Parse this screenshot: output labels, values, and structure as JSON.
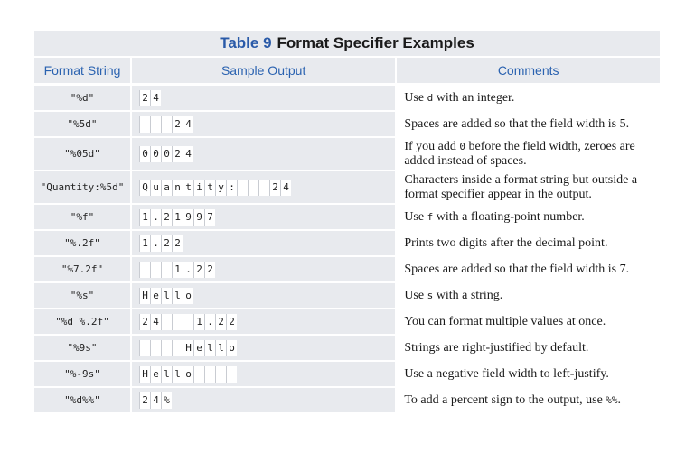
{
  "table": {
    "title_number": "Table 9",
    "title_text": "Format Specifier Examples",
    "headers": [
      "Format String",
      "Sample Output",
      "Comments"
    ],
    "rows": [
      {
        "format": "\"%d\"",
        "output": "24",
        "pad": 0,
        "comment": [
          [
            "t",
            "Use "
          ],
          [
            "c",
            "d"
          ],
          [
            "t",
            " with an integer."
          ]
        ]
      },
      {
        "format": "\"%5d\"",
        "output": "   24",
        "pad": 0,
        "comment": [
          [
            "t",
            "Spaces are added so that the field width is 5."
          ]
        ]
      },
      {
        "format": "\"%05d\"",
        "output": "00024",
        "pad": 0,
        "comment": [
          [
            "t",
            "If you add "
          ],
          [
            "c",
            "0"
          ],
          [
            "t",
            " before the field width, zeroes are added instead of spaces."
          ]
        ]
      },
      {
        "format": "\"Quantity:%5d\"",
        "output": "Quantity:   24",
        "pad": 0,
        "comment": [
          [
            "t",
            "Characters inside a format string but outside a format specifier appear in the output."
          ]
        ]
      },
      {
        "format": "\"%f\"",
        "output": "1.21997",
        "pad": 0,
        "comment": [
          [
            "t",
            "Use "
          ],
          [
            "c",
            "f"
          ],
          [
            "t",
            " with a floating-point number."
          ]
        ]
      },
      {
        "format": "\"%.2f\"",
        "output": "1.22",
        "pad": 0,
        "comment": [
          [
            "t",
            "Prints two digits after the decimal point."
          ]
        ]
      },
      {
        "format": "\"%7.2f\"",
        "output": "   1.22",
        "pad": 0,
        "comment": [
          [
            "t",
            "Spaces are added so that the field width is 7."
          ]
        ]
      },
      {
        "format": "\"%s\"",
        "output": "Hello",
        "pad": 0,
        "comment": [
          [
            "t",
            "Use "
          ],
          [
            "c",
            "s"
          ],
          [
            "t",
            " with a string."
          ]
        ]
      },
      {
        "format": "\"%d %.2f\"",
        "output": "24   1.22",
        "pad": 0,
        "comment": [
          [
            "t",
            "You can format multiple values at once."
          ]
        ]
      },
      {
        "format": "\"%9s\"",
        "output": "    Hello",
        "pad": 0,
        "comment": [
          [
            "t",
            "Strings are right-justified by default."
          ]
        ]
      },
      {
        "format": "\"%-9s\"",
        "output": "Hello    ",
        "pad": 0,
        "comment": [
          [
            "t",
            "Use a negative field width to left-justify."
          ]
        ]
      },
      {
        "format": "\"%d%%\"",
        "output": "24%",
        "pad": 0,
        "comment": [
          [
            "t",
            "To add a percent sign to the output, use "
          ],
          [
            "c",
            "%%"
          ],
          [
            "t",
            "."
          ]
        ]
      }
    ]
  }
}
